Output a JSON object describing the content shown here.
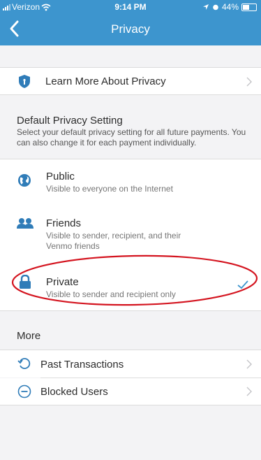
{
  "status_bar": {
    "carrier": "Verizon",
    "time": "9:14 PM",
    "battery": "44%"
  },
  "nav": {
    "title": "Privacy",
    "back_icon": "chevron-left-icon"
  },
  "learn_more": {
    "label": "Learn More About Privacy",
    "icon": "shield-icon"
  },
  "default_setting": {
    "heading": "Default Privacy Setting",
    "description": "Select your default privacy setting for all future payments. You can also change it for each payment individually."
  },
  "options": [
    {
      "title": "Public",
      "subtitle": "Visible to everyone on the Internet",
      "icon": "globe-icon",
      "selected": false
    },
    {
      "title": "Friends",
      "subtitle": "Visible to sender, recipient, and their Venmo friends",
      "icon": "friends-icon",
      "selected": false
    },
    {
      "title": "Private",
      "subtitle": "Visible to sender and recipient only",
      "icon": "lock-icon",
      "selected": true
    }
  ],
  "more": {
    "heading": "More",
    "items": [
      {
        "label": "Past Transactions",
        "icon": "history-icon"
      },
      {
        "label": "Blocked Users",
        "icon": "blocked-icon"
      }
    ]
  },
  "colors": {
    "accent": "#3d95ce",
    "annotation": "#d4141f"
  }
}
